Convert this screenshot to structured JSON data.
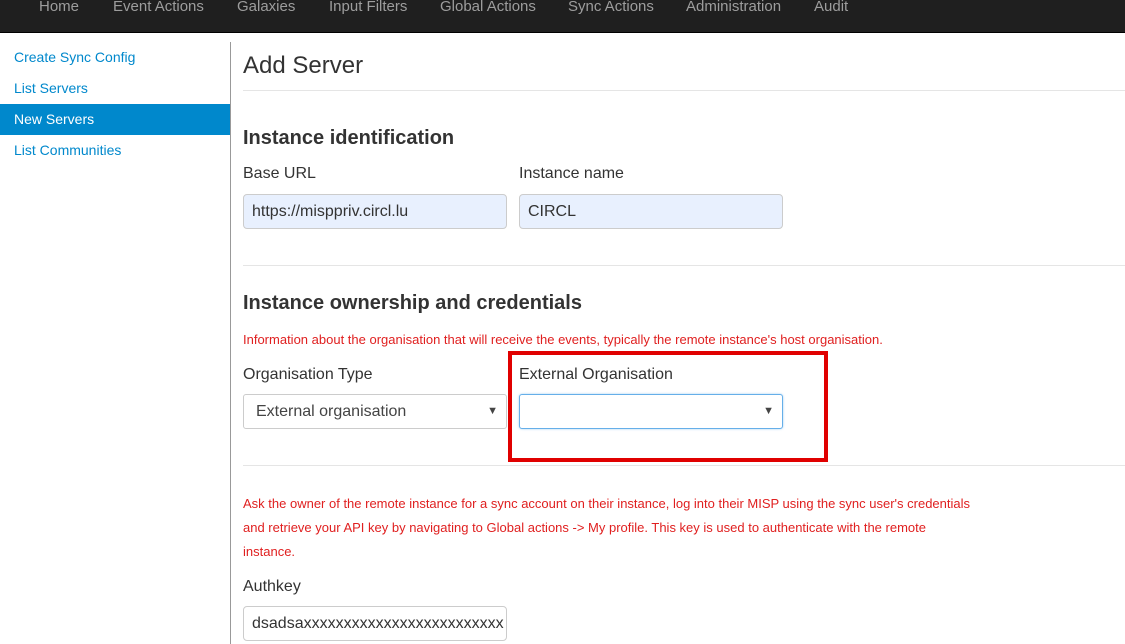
{
  "topnav": {
    "items": [
      "Home",
      "Event Actions",
      "Galaxies",
      "Input Filters",
      "Global Actions",
      "Sync Actions",
      "Administration",
      "Audit"
    ]
  },
  "sidebar": {
    "items": [
      {
        "label": "Create Sync Config",
        "active": false
      },
      {
        "label": "List Servers",
        "active": false
      },
      {
        "label": "New Servers",
        "active": true
      },
      {
        "label": "List Communities",
        "active": false
      }
    ]
  },
  "main": {
    "title": "Add Server",
    "identification": {
      "heading": "Instance identification",
      "base_url_label": "Base URL",
      "base_url_value": "https://misppriv.circl.lu",
      "instance_name_label": "Instance name",
      "instance_name_value": "CIRCL"
    },
    "ownership": {
      "heading": "Instance ownership and credentials",
      "info": "Information about the organisation that will receive the events, typically the remote instance's host organisation.",
      "org_type_label": "Organisation Type",
      "org_type_value": "External organisation",
      "external_org_label": "External Organisation",
      "external_org_value": ""
    },
    "credentials": {
      "note_line1": "Ask the owner of the remote instance for a sync account on their instance, log into their MISP using the sync user's credentials",
      "note_line2": "and retrieve your API key by navigating to Global actions -> My profile. This key is used to authenticate with the remote",
      "note_line3": "instance.",
      "authkey_label": "Authkey",
      "authkey_value": "dsadsaxxxxxxxxxxxxxxxxxxxxxxxxx"
    }
  },
  "colors": {
    "accent": "#0088cc",
    "note": "#e02020",
    "highlight": "#e00000",
    "navbar": "#1f1f1f"
  }
}
